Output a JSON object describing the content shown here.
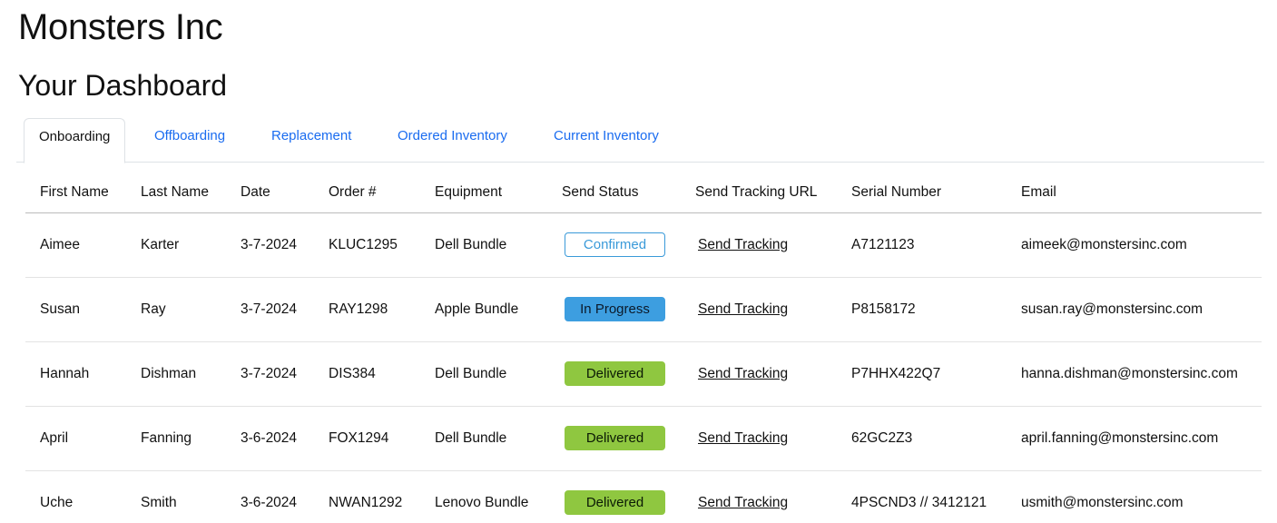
{
  "company": "Monsters Inc",
  "page_title": "Your Dashboard",
  "tabs": [
    {
      "label": "Onboarding",
      "active": true
    },
    {
      "label": "Offboarding",
      "active": false
    },
    {
      "label": "Replacement",
      "active": false
    },
    {
      "label": "Ordered Inventory",
      "active": false
    },
    {
      "label": "Current Inventory",
      "active": false
    }
  ],
  "table": {
    "headers": [
      "First Name",
      "Last Name",
      "Date",
      "Order #",
      "Equipment",
      "Send Status",
      "Send Tracking URL",
      "Serial Number",
      "Email"
    ],
    "rows": [
      {
        "first": "Aimee",
        "last": "Karter",
        "date": "3-7-2024",
        "order": "KLUC1295",
        "equipment": "Dell Bundle",
        "status": "Confirmed",
        "tracking": "Send Tracking",
        "serial": "A7121123",
        "email": "aimeek@monstersinc.com"
      },
      {
        "first": "Susan",
        "last": "Ray",
        "date": "3-7-2024",
        "order": "RAY1298",
        "equipment": "Apple Bundle",
        "status": "In Progress",
        "tracking": "Send Tracking",
        "serial": "P8158172",
        "email": "susan.ray@monstersinc.com"
      },
      {
        "first": "Hannah",
        "last": "Dishman",
        "date": "3-7-2024",
        "order": "DIS384",
        "equipment": "Dell Bundle",
        "status": "Delivered",
        "tracking": "Send Tracking",
        "serial": "P7HHX422Q7",
        "email": "hanna.dishman@monstersinc.com"
      },
      {
        "first": "April",
        "last": "Fanning",
        "date": "3-6-2024",
        "order": "FOX1294",
        "equipment": "Dell Bundle",
        "status": "Delivered",
        "tracking": "Send Tracking",
        "serial": "62GC2Z3",
        "email": "april.fanning@monstersinc.com"
      },
      {
        "first": "Uche",
        "last": "Smith",
        "date": "3-6-2024",
        "order": "NWAN1292",
        "equipment": "Lenovo Bundle",
        "status": "Delivered",
        "tracking": "Send Tracking",
        "serial": "4PSCND3 // 3412121",
        "email": "usmith@monstersinc.com"
      }
    ]
  },
  "colors": {
    "link": "#1a6cf0",
    "confirmed": "#3a9ad9",
    "in_progress": "#3d9ee0",
    "delivered": "#8fc740"
  }
}
